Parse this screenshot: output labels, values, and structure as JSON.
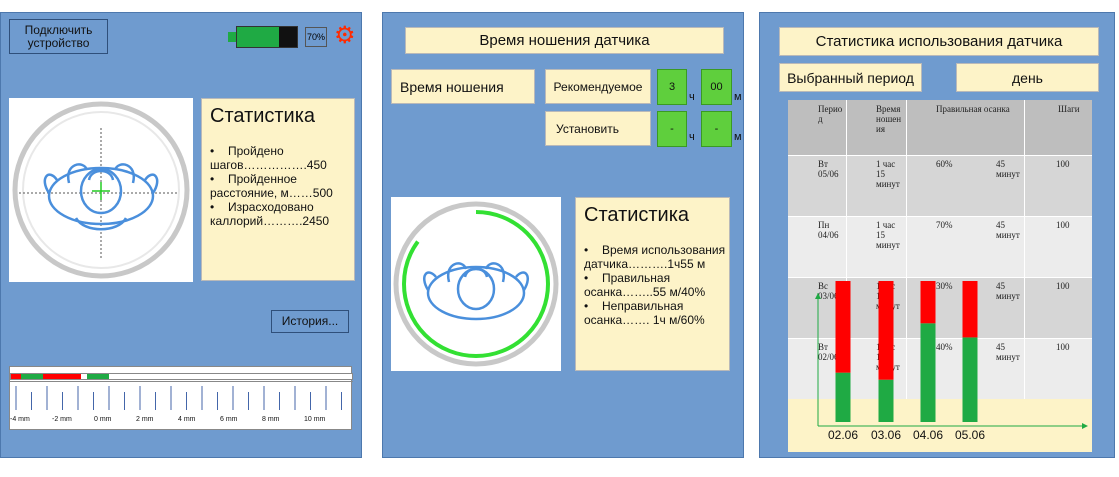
{
  "panel1": {
    "connect_label": "Подключить устройство",
    "battery_percent": "70%",
    "battery_level": 0.7,
    "stats_title": "Статистика",
    "stats": [
      "Пройдено шагов…………….450",
      "Пройденное расстояние, м……500",
      "Израсходовано каллорий……….2450"
    ],
    "history_label": "История...",
    "ruler_labels": [
      "-4 mm",
      "-2 mm",
      "0 mm",
      "2 mm",
      "4 mm",
      "6 mm",
      "8 mm",
      "10 mm"
    ]
  },
  "panel2": {
    "title": "Время ношения датчика",
    "wear_time_label": "Время ношения",
    "recommended_label": "Рекомендуемое",
    "set_label": "Установить",
    "rec_hours": "3",
    "rec_minutes": "00",
    "set_hours": "-",
    "set_minutes": "-",
    "unit_hours": "ч",
    "unit_minutes": "м",
    "progress_fraction": 0.85,
    "stats_title": "Статистика",
    "stats": [
      "Время использования датчика……….1ч55 м",
      "Правильная осанка……..55 м/40%",
      "Неправильная осанка……. 1ч  м/60%"
    ]
  },
  "panel3": {
    "title": "Статистика использования датчика",
    "period_label": "Выбранный период",
    "period_value": "день",
    "table_headers": [
      "Период",
      "Время ношения",
      "Правильная осанка",
      "Шаги"
    ],
    "rows": [
      {
        "period": "Вт 05/06",
        "wear": "1 час 15 минут",
        "pct": "60%",
        "mins": "45 минут",
        "steps": "100"
      },
      {
        "period": "Пн 04/06",
        "wear": "1 час 15 минут",
        "pct": "70%",
        "mins": "45 минут",
        "steps": "100"
      },
      {
        "period": "Вс 03/06",
        "wear": "1 час 15 минут",
        "pct": "30%",
        "mins": "45 минут",
        "steps": "100"
      },
      {
        "period": "Вт 02/06",
        "wear": "1 час 15 минут",
        "pct": "40%",
        "mins": "45 минут",
        "steps": "100"
      }
    ],
    "colors": {
      "good": "#1faa44",
      "bad": "#ff0000"
    }
  },
  "chart_data": {
    "type": "bar",
    "categories": [
      "02.06",
      "03.06",
      "04.06",
      "05.06"
    ],
    "series": [
      {
        "values": [
          0.35,
          0.3,
          0.7,
          0.6
        ]
      },
      {
        "values": [
          0.65,
          0.7,
          0.3,
          0.4
        ]
      }
    ],
    "ylim": [
      0,
      1
    ]
  }
}
